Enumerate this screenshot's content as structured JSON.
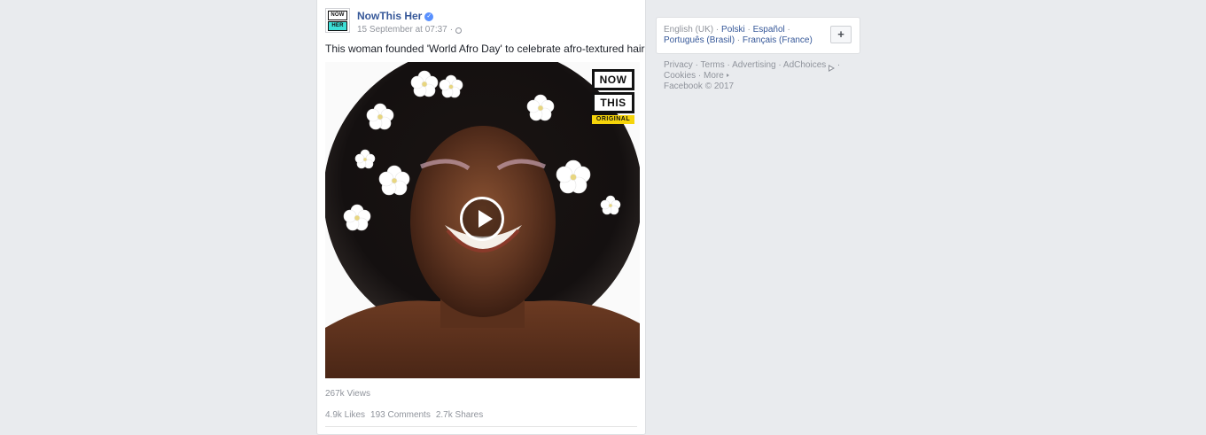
{
  "post": {
    "page_name": "NowThis Her",
    "logo_top": "NOW",
    "logo_bottom": "HER",
    "timestamp": "15 September at 07:37",
    "meta_sep": "·",
    "text": "This woman founded 'World Afro Day' to celebrate afro-textured hair",
    "video": {
      "badge_line1": "NOW",
      "badge_line2": "THIS",
      "badge_line3": "ORIGINAL"
    },
    "views": "267k Views",
    "likes": "4.9k Likes",
    "comments": "193 Comments",
    "shares": "2.7k Shares"
  },
  "languages": {
    "current": "English (UK)",
    "sep": " · ",
    "items": [
      "Polski",
      "Español",
      "Português (Brasil)",
      "Français (France)"
    ],
    "add_label": "+"
  },
  "footer": {
    "links": [
      "Privacy",
      "Terms",
      "Advertising",
      "AdChoices",
      "Cookies",
      "More"
    ],
    "copyright": "Facebook © 2017"
  },
  "colors": {
    "link_blue": "#365899",
    "meta_gray": "#90949c",
    "page_bg": "#e9ebee",
    "verified_blue": "#5890ff",
    "badge_yellow": "#f5d40a"
  },
  "icons": [
    "verified-icon",
    "globe-icon",
    "play-icon",
    "adchoices-icon",
    "more-caret-icon",
    "plus-icon"
  ]
}
